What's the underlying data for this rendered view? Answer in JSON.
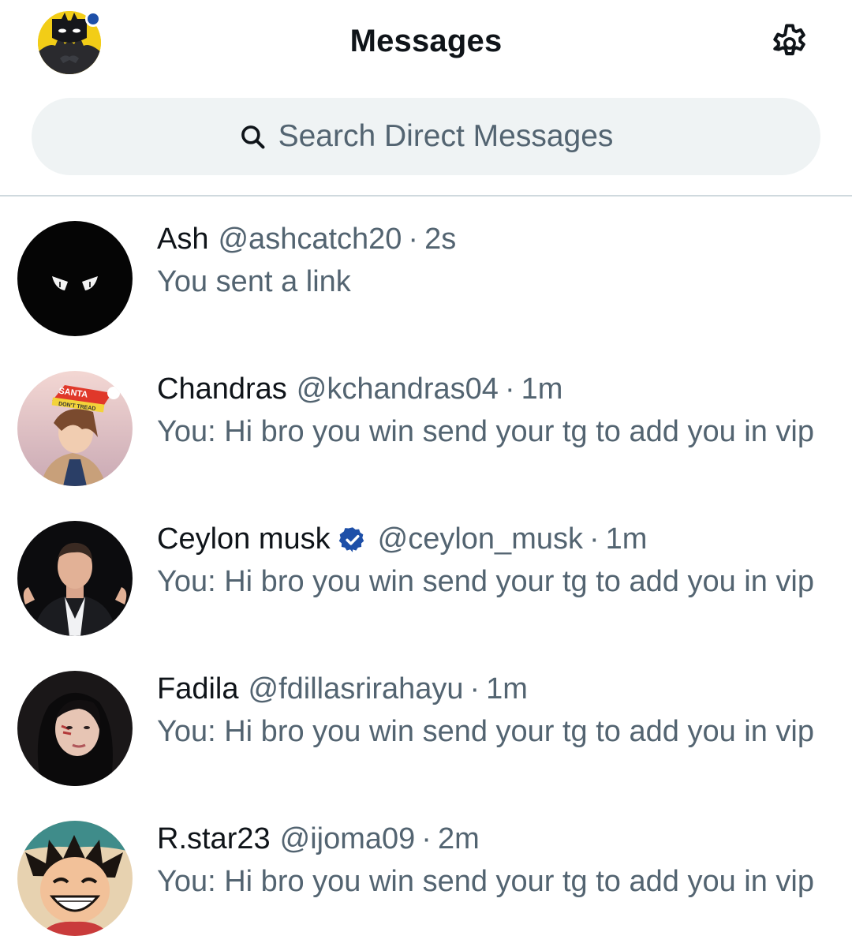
{
  "header": {
    "title": "Messages",
    "avatar_icon": "batman-avatar-icon",
    "settings_icon": "gear-icon"
  },
  "search": {
    "placeholder": "Search Direct Messages",
    "icon": "search-icon"
  },
  "colors": {
    "text_primary": "#0f1419",
    "text_secondary": "#536471",
    "search_bg": "#eff3f4",
    "divider": "#cfd9de",
    "verified_blue": "#1d9bf0"
  },
  "conversations": [
    {
      "name": "Ash",
      "handle": "@ashcatch20",
      "separator": "·",
      "time": "2s",
      "preview": "You sent a link",
      "verified": false,
      "avatar_icon": "dark-eyes-avatar-icon"
    },
    {
      "name": "Chandras",
      "handle": "@kchandras04",
      "separator": "·",
      "time": "1m",
      "preview": "You: Hi bro you win send your tg to add you in vip",
      "verified": false,
      "avatar_icon": "santa-hat-avatar-icon",
      "avatar_hat_text_1": "SANTA",
      "avatar_hat_text_2": "DON'T TREAD"
    },
    {
      "name": "Ceylon musk",
      "handle": "@ceylon_musk",
      "separator": "·",
      "time": "1m",
      "preview": "You: Hi bro you win send your tg to add you in vip",
      "verified": true,
      "avatar_icon": "man-portrait-avatar-icon"
    },
    {
      "name": "Fadila",
      "handle": "@fdillasrirahayu",
      "separator": "·",
      "time": "1m",
      "preview": "You: Hi bro you win send your tg to add you in vip",
      "verified": false,
      "avatar_icon": "woman-portrait-avatar-icon"
    },
    {
      "name": "R.star23",
      "handle": "@ijoma09",
      "separator": "·",
      "time": "2m",
      "preview": "You: Hi bro you win send your tg to add you in vip",
      "verified": false,
      "avatar_icon": "anime-boy-avatar-icon"
    }
  ]
}
